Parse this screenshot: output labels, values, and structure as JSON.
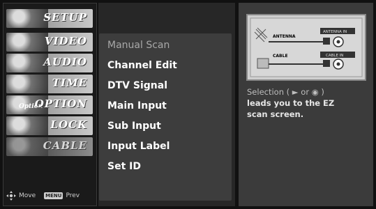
{
  "sidebar": {
    "tabs": [
      {
        "label": "SETUP",
        "icon": "setup-icon"
      },
      {
        "label": "VIDEO",
        "icon": "video-icon"
      },
      {
        "label": "AUDIO",
        "icon": "audio-icon"
      },
      {
        "label": "TIME",
        "icon": "time-icon"
      },
      {
        "label": "OPTION",
        "icon": "option-icon",
        "badge": "Option"
      },
      {
        "label": "LOCK",
        "icon": "lock-icon"
      },
      {
        "label": "CABLE",
        "icon": "cable-icon"
      }
    ],
    "footer": {
      "move_label": "Move",
      "prev_key": "MENU",
      "prev_label": "Prev"
    }
  },
  "menu": {
    "items": [
      {
        "label": "Manual Scan",
        "state": "dimmed"
      },
      {
        "label": "Channel Edit"
      },
      {
        "label": "DTV Signal"
      },
      {
        "label": "Main Input"
      },
      {
        "label": "Sub Input"
      },
      {
        "label": "Input Label"
      },
      {
        "label": "Set ID"
      }
    ]
  },
  "info": {
    "diagram": {
      "antenna_label": "ANTENNA",
      "cable_label": "CABLE",
      "in_label": "ANTENNA IN",
      "cable_in_label": "CABLE IN"
    },
    "description": {
      "line1": "Selection ( ► or ◉ )",
      "line2": "leads you to the EZ",
      "line3": "scan screen."
    }
  }
}
